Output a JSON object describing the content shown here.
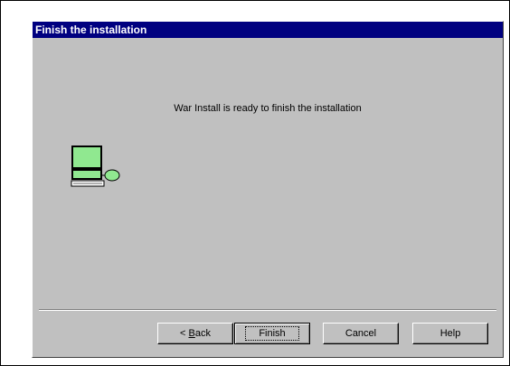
{
  "window": {
    "title": "Finish the installation"
  },
  "main": {
    "message": "War Install is ready to finish the installation"
  },
  "icons": {
    "computer": "computer-icon"
  },
  "buttons": {
    "back_prefix": "< ",
    "back_access": "B",
    "back_rest": "ack",
    "finish": "Finish",
    "cancel": "Cancel",
    "help": "Help"
  },
  "colors": {
    "titlebar": "#000080",
    "dialog_bg": "#c0c0c0",
    "icon_green": "#90e890"
  }
}
